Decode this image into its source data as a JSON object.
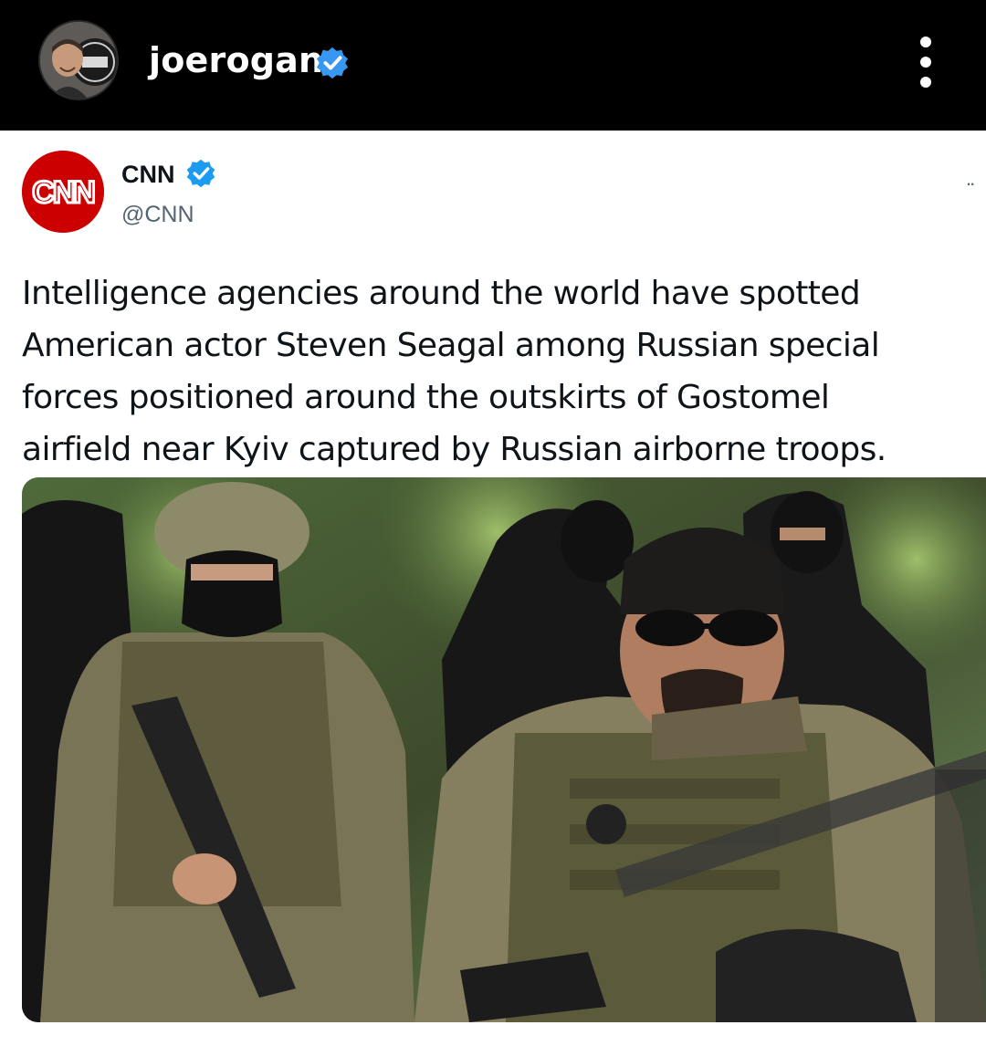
{
  "header": {
    "username": "joerogan",
    "avatar_icon": "profile-avatar",
    "verified_icon": "verified-badge-icon",
    "more_icon": "more-options-icon",
    "verified_color": "#3897f0"
  },
  "tweet": {
    "author_name": "CNN",
    "author_handle": "@CNN",
    "logo_text": "CNN",
    "logo_color": "#cc0000",
    "verified_color": "#1d9bf0",
    "more_text": "..",
    "text_lines": [
      "Intelligence agencies around the world have spotted",
      "American actor Steven Seagal among Russian special",
      "forces positioned around the outskirts of Gostomel",
      "airfield near Kyiv captured by Russian airborne troops."
    ],
    "photo_description": "armed-soldiers-photo"
  }
}
